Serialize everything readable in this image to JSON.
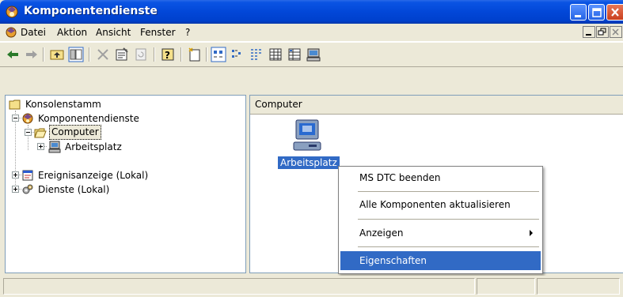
{
  "window": {
    "title": "Komponentendienste"
  },
  "menubar": {
    "items": [
      "Datei",
      "Aktion",
      "Ansicht",
      "Fenster",
      "?"
    ]
  },
  "tree": {
    "root": "Konsolenstamm",
    "items": [
      {
        "label": "Komponentendienste",
        "icon": "component-services-icon"
      },
      {
        "label": "Computer",
        "icon": "folder-open-icon",
        "selected": true
      },
      {
        "label": "Arbeitsplatz",
        "icon": "computer-icon"
      },
      {
        "label": "Ereignisanzeige (Lokal)",
        "icon": "event-viewer-icon"
      },
      {
        "label": "Dienste (Lokal)",
        "icon": "services-gears-icon"
      }
    ]
  },
  "right": {
    "header": "Computer",
    "item_label": "Arbeitsplatz"
  },
  "context_menu": {
    "items": [
      "MS DTC beenden",
      "Alle Komponenten aktualisieren",
      "Anzeigen",
      "Eigenschaften"
    ],
    "highlighted": "Eigenschaften"
  },
  "colors": {
    "titlebar": "#0247d8",
    "selection": "#316ac5",
    "chrome": "#ece9d8"
  }
}
